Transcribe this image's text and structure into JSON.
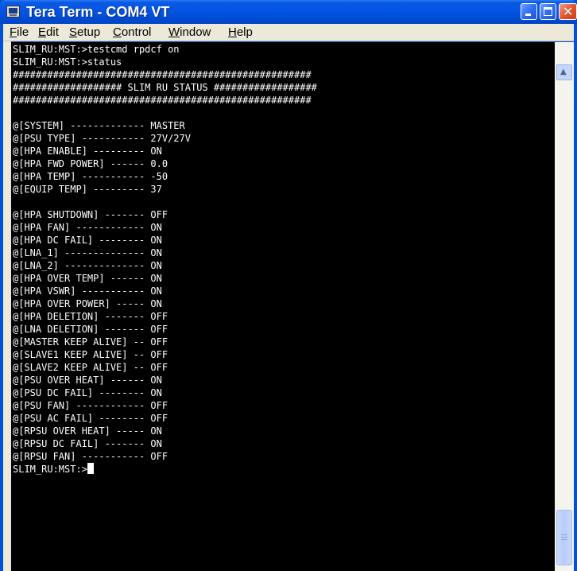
{
  "window": {
    "title": "Tera Term - COM4 VT"
  },
  "menu": [
    {
      "key": "F",
      "rest": "ile"
    },
    {
      "key": "E",
      "rest": "dit"
    },
    {
      "key": "S",
      "rest": "etup"
    },
    {
      "key": "C",
      "rest": "ontrol"
    },
    {
      "key": "W",
      "rest": "indow"
    },
    {
      "key": "H",
      "rest": "elp"
    }
  ],
  "terminal": {
    "lines": [
      "SLIM_RU:MST:>testcmd rpdcf on",
      "SLIM_RU:MST:>status",
      "####################################################",
      "################### SLIM RU STATUS ##################",
      "####################################################",
      "",
      "@[SYSTEM] ------------- MASTER",
      "@[PSU TYPE] ----------- 27V/27V",
      "@[HPA ENABLE] --------- ON",
      "@[HPA FWD POWER] ------ 0.0",
      "@[HPA TEMP] ----------- -50",
      "@[EQUIP TEMP] --------- 37",
      "",
      "@[HPA SHUTDOWN] ------- OFF",
      "@[HPA FAN] ------------ ON",
      "@[HPA DC FAIL] -------- ON",
      "@[LNA_1] -------------- ON",
      "@[LNA_2] -------------- ON",
      "@[HPA OVER TEMP] ------ ON",
      "@[HPA VSWR] ----------- ON",
      "@[HPA OVER POWER] ----- ON",
      "@[HPA DELETION] ------- OFF",
      "@[LNA DELETION] ------- OFF",
      "@[MASTER KEEP ALIVE] -- OFF",
      "@[SLAVE1 KEEP ALIVE] -- OFF",
      "@[SLAVE2 KEEP ALIVE] -- OFF",
      "@[PSU OVER HEAT] ------ ON",
      "@[PSU DC FAIL] -------- ON",
      "@[PSU FAN] ------------ OFF",
      "@[PSU AC FAIL] -------- OFF",
      "@[RPSU OVER HEAT] ----- ON",
      "@[RPSU DC FAIL] ------- ON",
      "@[RPSU FAN] ----------- OFF"
    ],
    "prompt": "SLIM_RU:MST:>"
  },
  "colors": {
    "terminal_bg": "#000000",
    "terminal_fg": "#ffffff",
    "titlebar": "#0253e0",
    "menubar": "#ece9d8"
  },
  "icons": {
    "app": "teraterm-icon",
    "minimize": "minimize-icon",
    "maximize": "maximize-icon",
    "close": "close-icon",
    "scroll_up": "scroll-up-arrow-icon"
  }
}
